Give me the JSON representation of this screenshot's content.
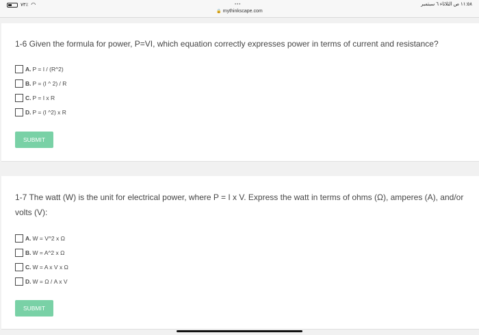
{
  "status_bar": {
    "left_text": "٧٣٪",
    "right_text": "١١:٥٨ ص   الثلاثاء ٦ سبتمبر",
    "url": "mythinkscape.com"
  },
  "questions": [
    {
      "text": "1-6 Given the formula for power, P=VI, which equation correctly expresses power in terms of current and resistance?",
      "options": [
        {
          "letter": "A.",
          "text": "P = I / (R^2)"
        },
        {
          "letter": "B.",
          "text": "P = (I ^ 2) / R"
        },
        {
          "letter": "C.",
          "text": "P = I x R"
        },
        {
          "letter": "D.",
          "text": "P = (I ^2) x R"
        }
      ],
      "submit_label": "SUBMIT"
    },
    {
      "text": "1-7 The watt (W) is the unit for electrical power, where P = I x V. Express the watt in terms of ohms (Ω), amperes (A), and/or volts (V):",
      "options": [
        {
          "letter": "A.",
          "text": " W = V^2 x Ω"
        },
        {
          "letter": "B.",
          "text": " W = A^2 x Ω"
        },
        {
          "letter": "C.",
          "text": " W = A x V x Ω"
        },
        {
          "letter": "D.",
          "text": "W = Ω / A x V"
        }
      ],
      "submit_label": "SUBMIT"
    }
  ],
  "colors": {
    "submit_bg": "#79d1a6",
    "page_bg": "#f1f1f1"
  }
}
